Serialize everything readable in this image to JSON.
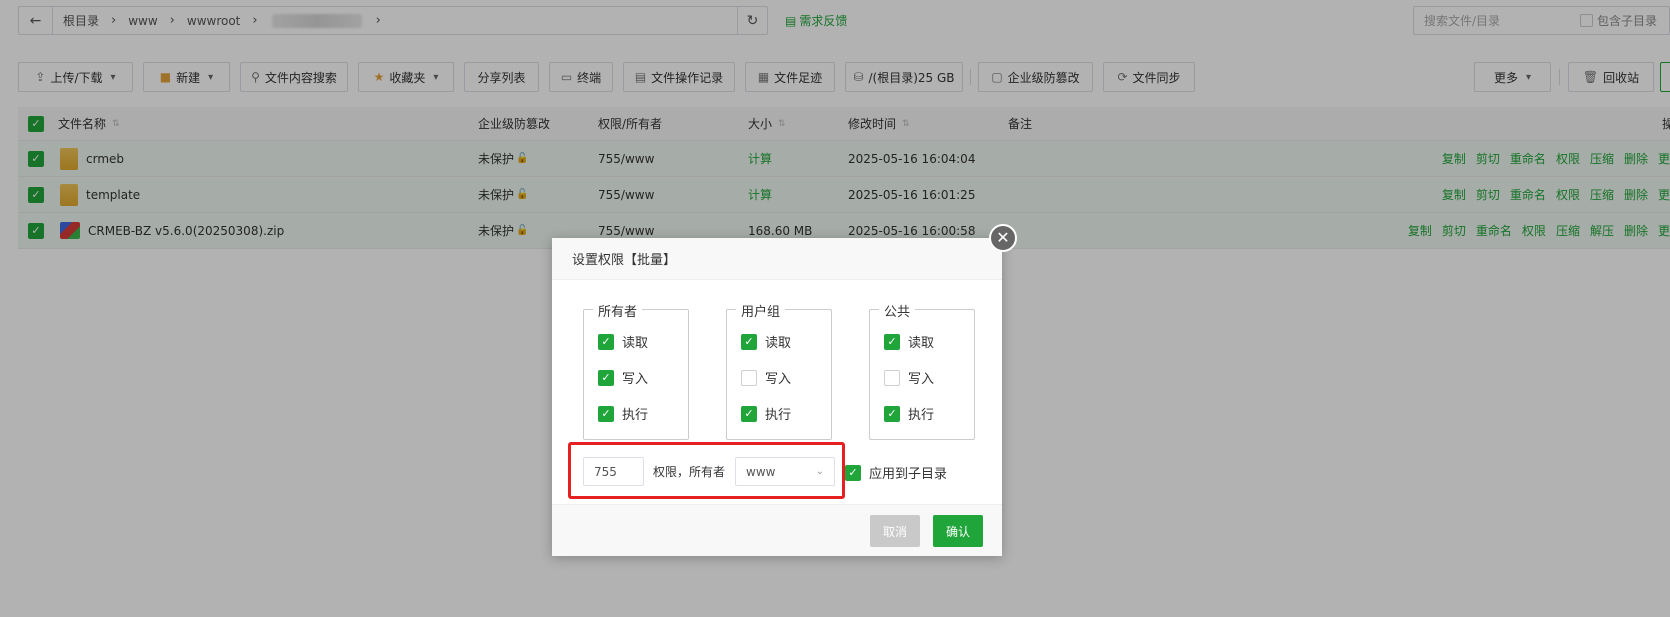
{
  "path": {
    "crumbs": [
      "根目录",
      "www",
      "wwwroot"
    ],
    "feedback": "需求反馈"
  },
  "search": {
    "placeholder": "搜索文件/目录",
    "include_sub": "包含子目录"
  },
  "toolbar": {
    "upload": "上传/下载",
    "new": "新建",
    "content_search": "文件内容搜索",
    "favorites": "收藏夹",
    "share_list": "分享列表",
    "terminal": "终端",
    "op_log": "文件操作记录",
    "footprint": "文件足迹",
    "disk": "/(根目录)25 GB",
    "tamper": "企业级防篡改",
    "sync": "文件同步",
    "more": "更多",
    "recycle": "回收站"
  },
  "table": {
    "headers": {
      "name": "文件名称",
      "tamper": "企业级防篡改",
      "perm": "权限/所有者",
      "size": "大小",
      "mtime": "修改时间",
      "remark": "备注",
      "ops": "操"
    },
    "rows": [
      {
        "name": "crmeb",
        "tamper": "未保护",
        "perm": "755/www",
        "size": "计算",
        "mtime": "2025-05-16 16:04:04",
        "ops": [
          "复制",
          "剪切",
          "重命名",
          "权限",
          "压缩",
          "删除",
          "更"
        ]
      },
      {
        "name": "template",
        "tamper": "未保护",
        "perm": "755/www",
        "size": "计算",
        "mtime": "2025-05-16 16:01:25",
        "ops": [
          "复制",
          "剪切",
          "重命名",
          "权限",
          "压缩",
          "删除",
          "更"
        ]
      },
      {
        "name": "CRMEB-BZ v5.6.0(20250308).zip",
        "tamper": "未保护",
        "perm": "755/www",
        "size": "168.60 MB",
        "mtime": "2025-05-16 16:00:58",
        "ops": [
          "复制",
          "剪切",
          "重命名",
          "权限",
          "压缩",
          "解压",
          "删除",
          "更"
        ]
      }
    ]
  },
  "modal": {
    "title": "设置权限【批量】",
    "groups": [
      {
        "title": "所有者",
        "read": "读取",
        "write": "写入",
        "exec": "执行",
        "read_on": true,
        "write_on": true,
        "exec_on": true
      },
      {
        "title": "用户组",
        "read": "读取",
        "write": "写入",
        "exec": "执行",
        "read_on": true,
        "write_on": false,
        "exec_on": true
      },
      {
        "title": "公共",
        "read": "读取",
        "write": "写入",
        "exec": "执行",
        "read_on": true,
        "write_on": false,
        "exec_on": true
      }
    ],
    "mode_value": "755",
    "perm_owner_label": "权限，所有者",
    "owner_value": "www",
    "apply_sub": "应用到子目录",
    "cancel": "取消",
    "confirm": "确认"
  },
  "colors": {
    "accent": "#20a53a",
    "highlight": "#e62020"
  }
}
